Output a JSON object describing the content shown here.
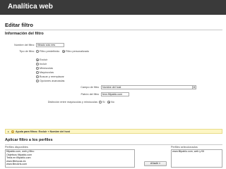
{
  "app": {
    "title": "Analítica web"
  },
  "page": {
    "title": "Editar filtro"
  },
  "filter_info": {
    "section_title": "Información del filtro",
    "name_label": "Nombre del filtro:",
    "name_value": "filtrado sólo ees",
    "type_label": "Tipo de filtro:",
    "type_options": [
      {
        "label": "Filtro predefinido",
        "checked": false
      },
      {
        "label": "Filtro personalizado",
        "checked": true
      }
    ],
    "custom_options": [
      {
        "label": "Excluir",
        "checked": true
      },
      {
        "label": "Incluir",
        "checked": false
      },
      {
        "label": "Minúsculas",
        "checked": false
      },
      {
        "label": "Mayúsculas",
        "checked": false
      },
      {
        "label": "Buscar y reemplazar",
        "checked": false
      },
      {
        "label": "Opciones avanzadas",
        "checked": false
      }
    ],
    "field_label": "Campo de filtro",
    "field_value": "Nombre del host",
    "pattern_label": "Patrón del filtro",
    "pattern_value": "fenn.filtpablo.com",
    "case_label": "Distinción entre mayúsculas y minúsculas",
    "case_options": [
      {
        "label": "Sí",
        "checked": false
      },
      {
        "label": "No",
        "checked": true
      }
    ],
    "help_text": "Ayuda para filtros: Excluir  »  Nombre del host"
  },
  "apply": {
    "section_title": "Aplicar filtro a los perfiles",
    "available_label": "Perfiles disponibles",
    "available_items": [
      "filtpablo.com, web y filtro",
      "Objetivos filtpablo.com",
      "Tests en filtpablo.com",
      "www.filtelucas.es",
      "www.filecArts.com"
    ],
    "selected_label": "Perfiles seleccionados",
    "selected_items": [
      "www.filtpablo.com, web y filt"
    ],
    "add_button": "Añadir »"
  }
}
